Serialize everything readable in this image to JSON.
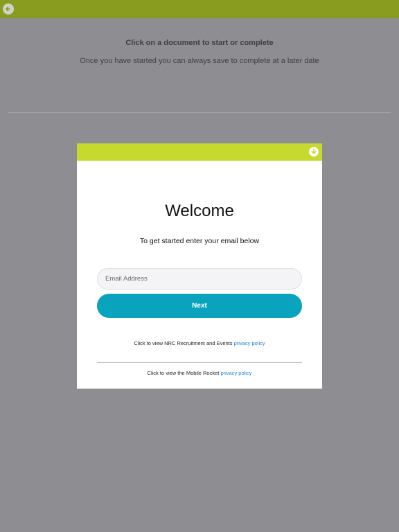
{
  "header": {
    "back_icon": "back-arrow-circle-icon",
    "color": "#8a9c1f"
  },
  "background": {
    "title": "Click on a document to start or complete",
    "subtitle": "Once you have started you can always save to complete at a later date"
  },
  "modal": {
    "header_color": "#c5d92e",
    "download_icon": "download-circle-icon",
    "welcome": "Welcome",
    "instruction": "To get started enter your email below",
    "email": {
      "value": "",
      "placeholder": "Email Address"
    },
    "next_label": "Next",
    "next_color": "#0aa3bd",
    "policy1": {
      "text": "Click to view NRC Recruitment and Events",
      "link": "privacy policy"
    },
    "policy2": {
      "text": "Click to view the Mobile Rocket",
      "link": "privacy policy"
    },
    "link_color": "#1f7fd6"
  }
}
